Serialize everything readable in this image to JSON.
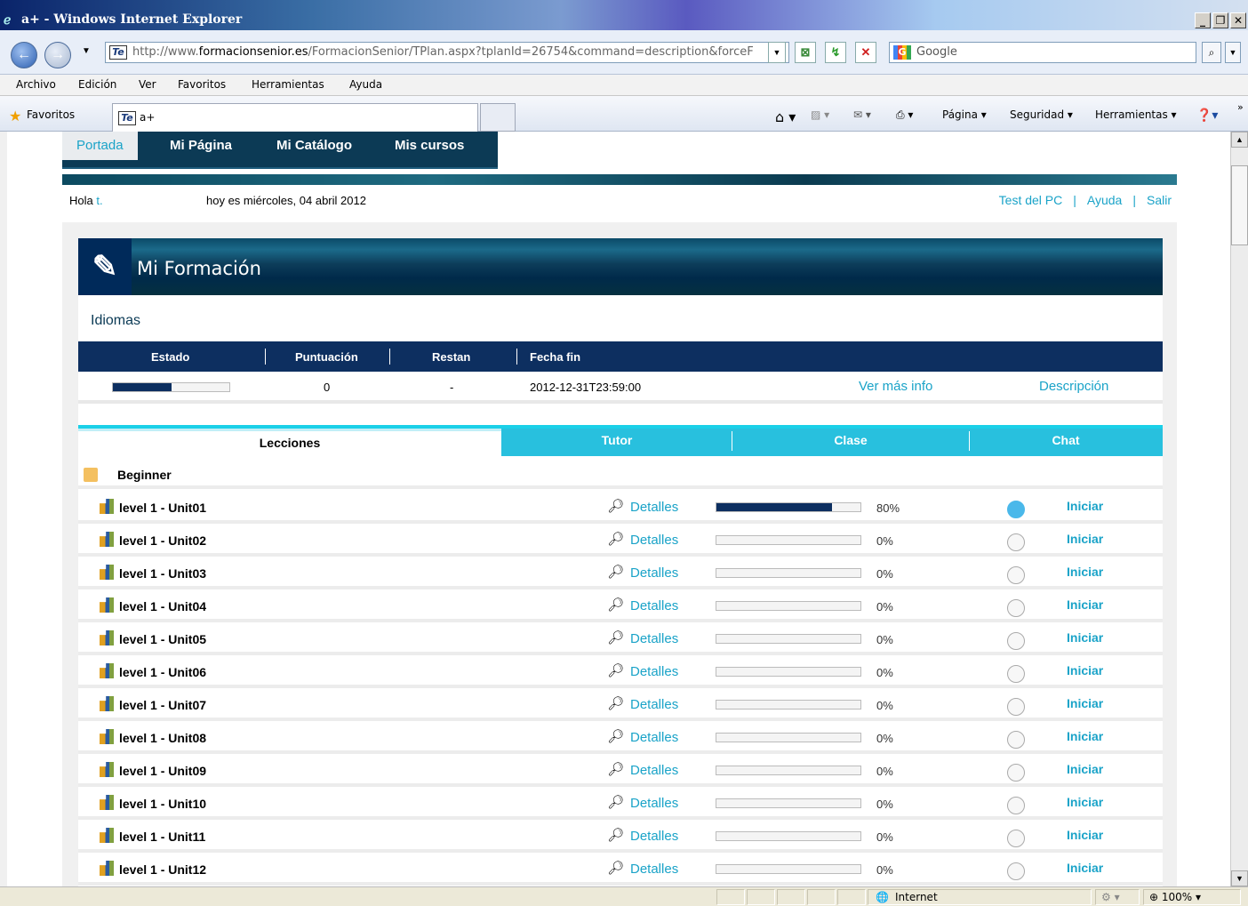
{
  "browser": {
    "title": "a+ - Windows Internet Explorer",
    "url_prefix": "http://www.",
    "url_domain": "formacionsenior.es",
    "url_path": "/FormacionSenior/TPlan.aspx?tplanId=26754&command=description&forceF",
    "search_placeholder": "Google",
    "menu": [
      "Archivo",
      "Edición",
      "Ver",
      "Favoritos",
      "Herramientas",
      "Ayuda"
    ],
    "favorites_label": "Favoritos",
    "tab_title": "a+",
    "commands": {
      "pagina": "Página ▾",
      "seguridad": "Seguridad ▾",
      "herramientas": "Herramientas ▾"
    },
    "status": {
      "zone": "Internet",
      "zoom": "100%"
    }
  },
  "page": {
    "nav": [
      "Portada",
      "Mi Página",
      "Mi Catálogo",
      "Mis cursos"
    ],
    "greeting": "Hola",
    "user": "t.",
    "date": "hoy es miércoles, 04 abril 2012",
    "links": [
      "Test del PC",
      "Ayuda",
      "Salir"
    ],
    "section_title": "Mi Formación",
    "course": "Idiomas",
    "status_headers": [
      "Estado",
      "Puntuación",
      "Restan",
      "Fecha fin"
    ],
    "status_row": {
      "progress": 0.5,
      "score": "0",
      "remaining": "-",
      "end_date": "2012-12-31T23:59:00",
      "more": "Ver más info",
      "desc": "Descripción"
    },
    "tabs": [
      "Lecciones",
      "Tutor",
      "Clase",
      "Chat"
    ],
    "group": "Beginner",
    "details_label": "Detalles",
    "start_label": "Iniciar",
    "lessons": [
      {
        "name": "level 1 - Unit01",
        "pct": "80%",
        "progress": 0.8,
        "done": true
      },
      {
        "name": "level 1 - Unit02",
        "pct": "0%",
        "progress": 0,
        "done": false
      },
      {
        "name": "level 1 - Unit03",
        "pct": "0%",
        "progress": 0,
        "done": false
      },
      {
        "name": "level 1 - Unit04",
        "pct": "0%",
        "progress": 0,
        "done": false
      },
      {
        "name": "level 1 - Unit05",
        "pct": "0%",
        "progress": 0,
        "done": false
      },
      {
        "name": "level 1 - Unit06",
        "pct": "0%",
        "progress": 0,
        "done": false
      },
      {
        "name": "level 1 - Unit07",
        "pct": "0%",
        "progress": 0,
        "done": false
      },
      {
        "name": "level 1 - Unit08",
        "pct": "0%",
        "progress": 0,
        "done": false
      },
      {
        "name": "level 1 - Unit09",
        "pct": "0%",
        "progress": 0,
        "done": false
      },
      {
        "name": "level 1 - Unit10",
        "pct": "0%",
        "progress": 0,
        "done": false
      },
      {
        "name": "level 1 - Unit11",
        "pct": "0%",
        "progress": 0,
        "done": false
      },
      {
        "name": "level 1 - Unit12",
        "pct": "0%",
        "progress": 0,
        "done": false
      }
    ]
  }
}
